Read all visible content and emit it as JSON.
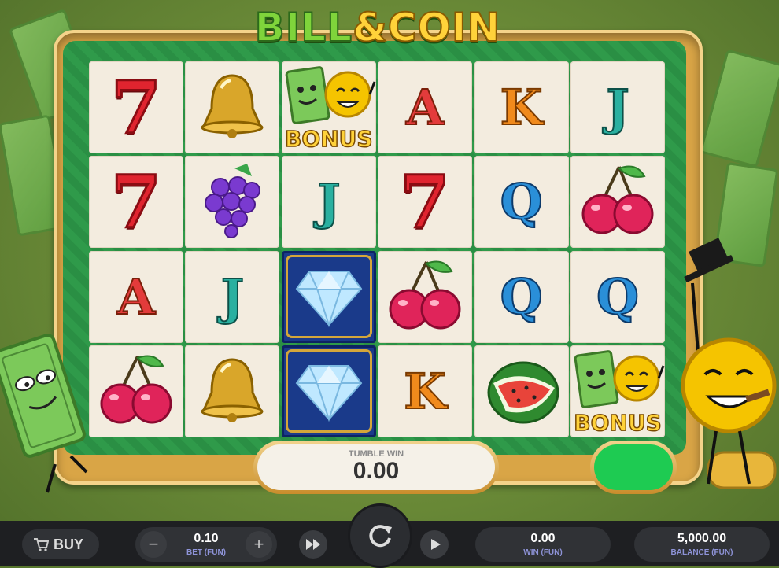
{
  "game": {
    "title_part1": "BILL",
    "title_amp": "&",
    "title_part2": "COIN"
  },
  "grid": {
    "rows": [
      [
        {
          "sym": "seven"
        },
        {
          "sym": "bell"
        },
        {
          "sym": "bonus",
          "label": "BONUS"
        },
        {
          "sym": "A",
          "label": "A"
        },
        {
          "sym": "K",
          "label": "K"
        },
        {
          "sym": "J",
          "label": "J"
        }
      ],
      [
        {
          "sym": "seven"
        },
        {
          "sym": "grapes"
        },
        {
          "sym": "J",
          "label": "J"
        },
        {
          "sym": "seven"
        },
        {
          "sym": "Q",
          "label": "Q"
        },
        {
          "sym": "cherry"
        }
      ],
      [
        {
          "sym": "A",
          "label": "A"
        },
        {
          "sym": "J",
          "label": "J"
        },
        {
          "sym": "diamond"
        },
        {
          "sym": "cherry"
        },
        {
          "sym": "Q",
          "label": "Q"
        },
        {
          "sym": "Q",
          "label": "Q"
        }
      ],
      [
        {
          "sym": "cherry"
        },
        {
          "sym": "bell"
        },
        {
          "sym": "diamond"
        },
        {
          "sym": "K",
          "label": "K"
        },
        {
          "sym": "watermelon"
        },
        {
          "sym": "bonus",
          "label": "BONUS"
        }
      ]
    ]
  },
  "tumble_win": {
    "label": "TUMBLE WIN",
    "value": "0.00"
  },
  "controls": {
    "buy_label": "BUY",
    "minus_label": "−",
    "plus_label": "+",
    "bet_value": "0.10",
    "bet_label": "BET (FUN)",
    "win_value": "0.00",
    "win_label": "WIN (FUN)",
    "balance_value": "5,000.00",
    "balance_label": "BALANCE (FUN)"
  },
  "icons": {
    "cart": "cart-icon",
    "fast_forward": "fast-forward-icon",
    "spin": "refresh-icon",
    "autoplay": "play-icon"
  },
  "colors": {
    "accent_green": "#1ecb52",
    "frame_gold": "#d9a546",
    "bar": "#1e1f22"
  }
}
